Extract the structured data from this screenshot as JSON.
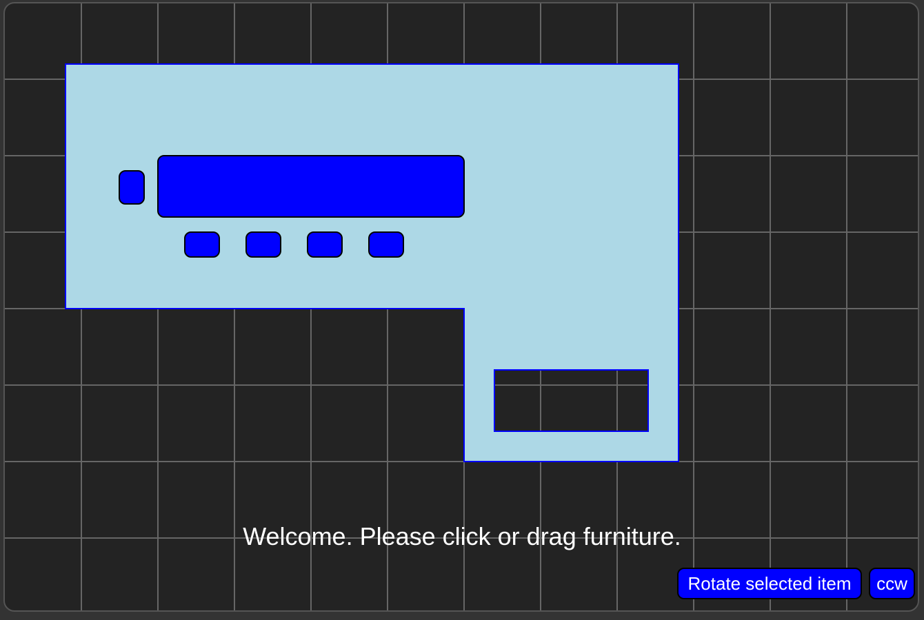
{
  "status_message": "Welcome. Please click or drag furniture.",
  "controls": {
    "rotate_label": "Rotate selected item",
    "direction_label": "ccw"
  },
  "colors": {
    "background": "#232323",
    "grid_line": "#666666",
    "room_fill": "#add8e6",
    "room_outline": "#0000ff",
    "furniture_fill": "#0000ff",
    "furniture_outline": "#000000",
    "button_fill": "#0000ff",
    "text": "#ffffff"
  }
}
